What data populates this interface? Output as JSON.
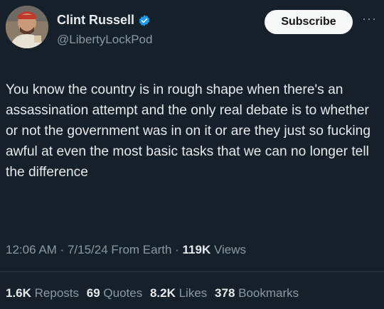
{
  "author": {
    "name": "Clint Russell",
    "handle": "@LibertyLockPod",
    "verified_icon": "verified-badge-icon"
  },
  "actions": {
    "subscribe_label": "Subscribe",
    "more_label": "···"
  },
  "post": {
    "text": "You know the country is in rough shape when there's an assassination attempt and the only real debate is to whether or not the government was in on it or are they just so fucking awful at even the most basic tasks that we can no longer tell the difference"
  },
  "meta": {
    "time": "12:06 AM",
    "sep1": " · ",
    "date": "7/15/24",
    "source": " From Earth",
    "sep2": " · ",
    "views_count": "119K",
    "views_label": " Views"
  },
  "stats": [
    {
      "count": "1.6K",
      "label": " Reposts"
    },
    {
      "count": "69",
      "label": " Quotes"
    },
    {
      "count": "8.2K",
      "label": " Likes"
    },
    {
      "count": "378",
      "label": " Bookmarks"
    }
  ],
  "colors": {
    "background": "#15202b",
    "text": "#e7e9ea",
    "muted": "#8b98a5",
    "verified": "#1d9bf0"
  }
}
